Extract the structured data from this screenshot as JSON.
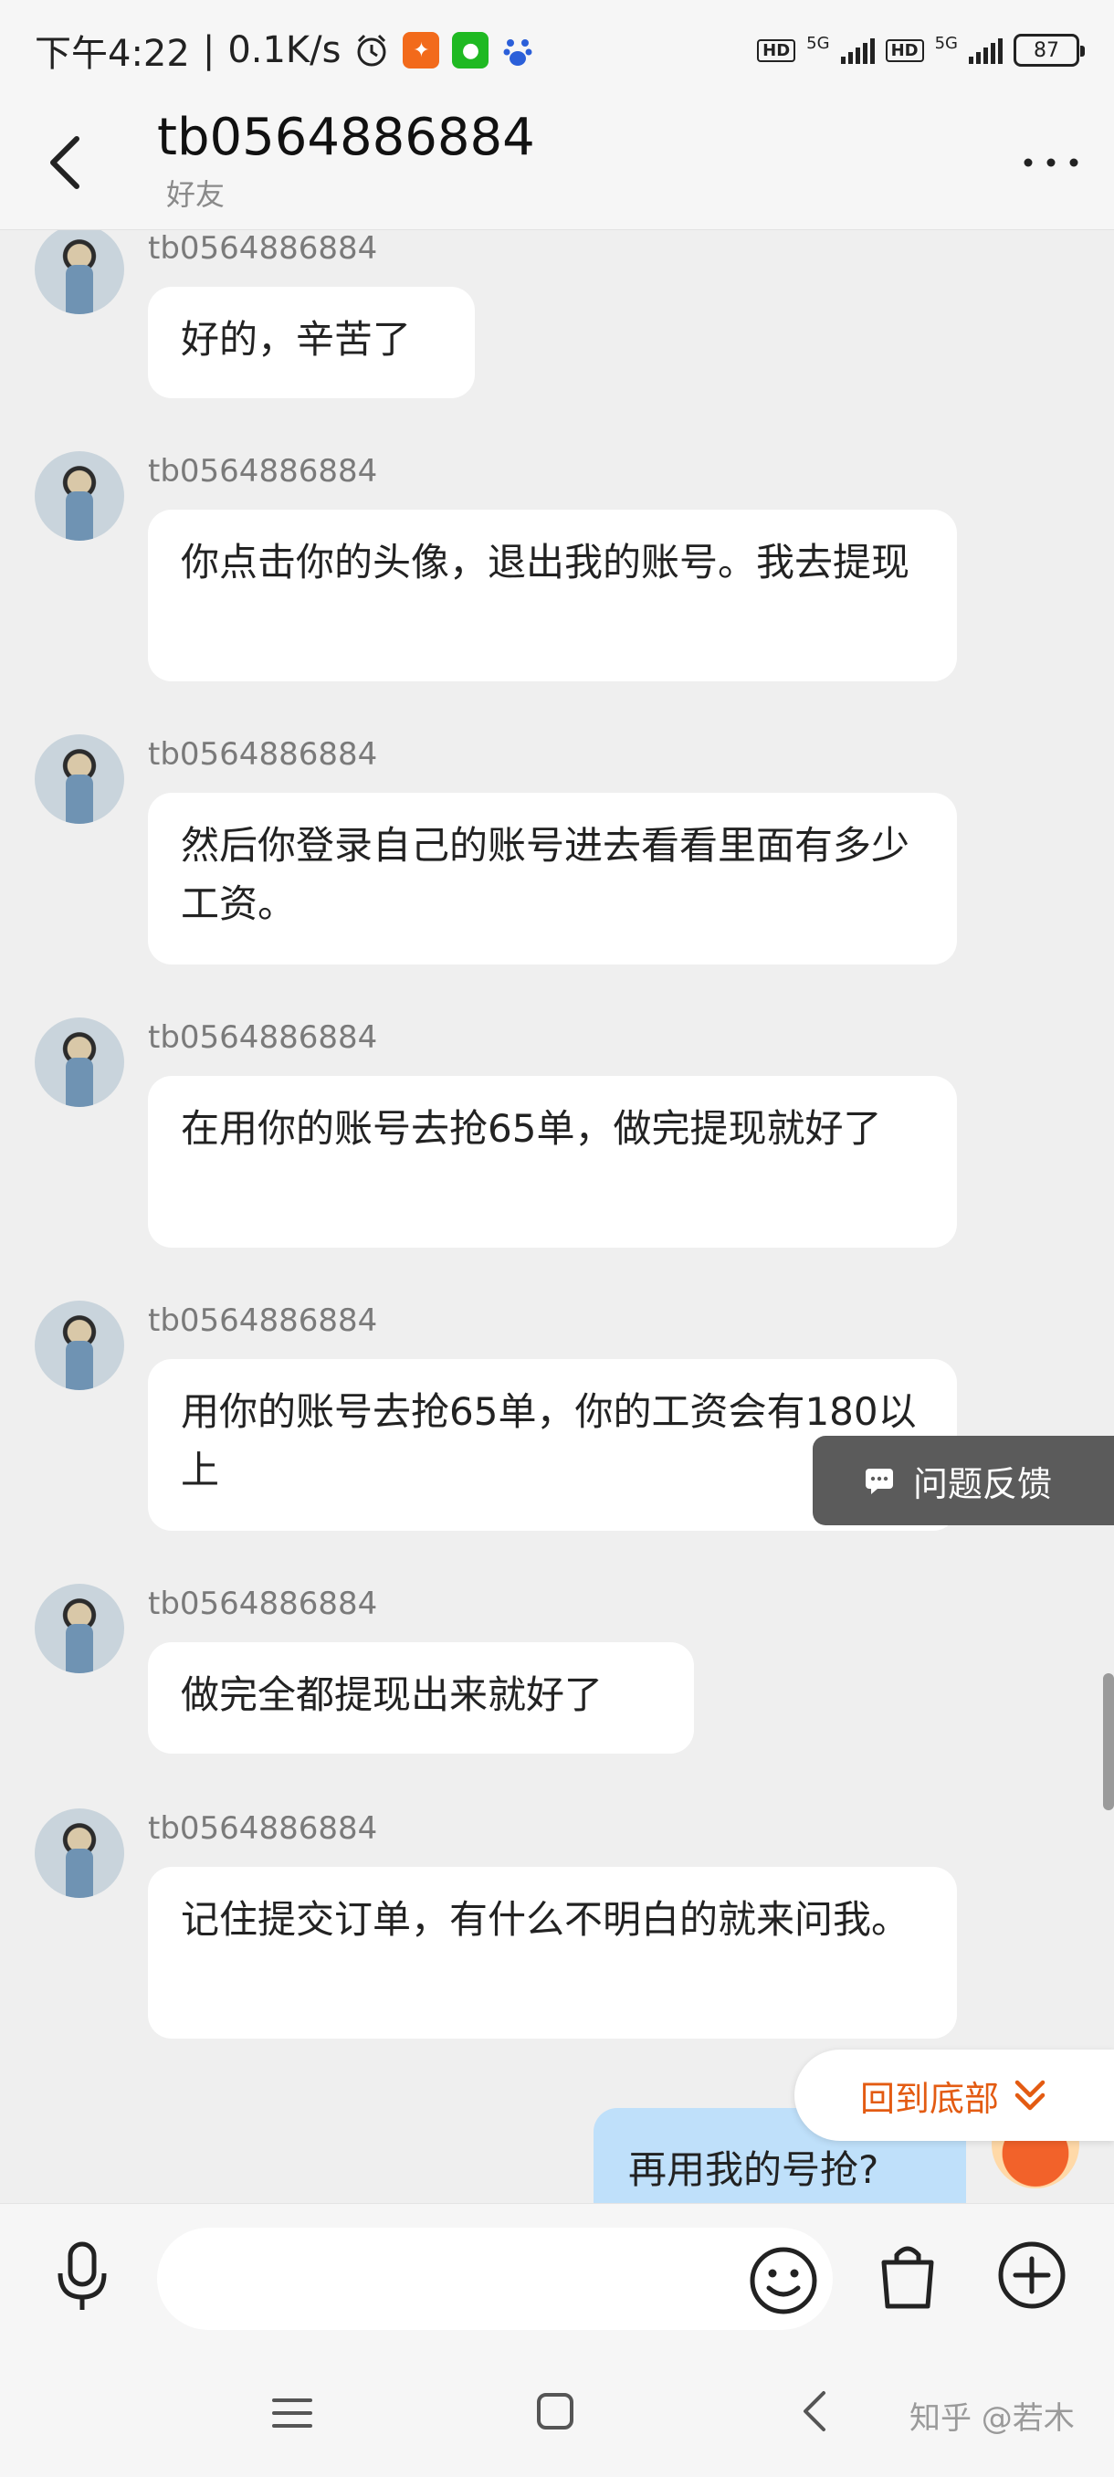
{
  "status_bar": {
    "time": "下午4:22",
    "speed": "0.1K/s",
    "net_label_1": "5G",
    "net_label_2": "5G",
    "hd_label": "HD",
    "battery": "87"
  },
  "header": {
    "title": "tb0564886884",
    "subtitle": "好友"
  },
  "messages": [
    {
      "sender": "tb0564886884",
      "text": "好的，辛苦了"
    },
    {
      "sender": "tb0564886884",
      "text": "你点击你的头像，退出我的账号。我去提现"
    },
    {
      "sender": "tb0564886884",
      "text": "然后你登录自己的账号进去看看里面有多少工资。"
    },
    {
      "sender": "tb0564886884",
      "text": "在用你的账号去抢65单，做完提现就好了"
    },
    {
      "sender": "tb0564886884",
      "text": "用你的账号去抢65单，你的工资会有180以上"
    },
    {
      "sender": "tb0564886884",
      "text": "做完全都提现出来就好了"
    },
    {
      "sender": "tb0564886884",
      "text": "记住提交订单，有什么不明白的就来问我。"
    }
  ],
  "my_message": {
    "text": "再用我的号抢?"
  },
  "floating": {
    "feedback_label": "问题反馈",
    "back_to_bottom_label": "回到底部"
  },
  "watermark": "知乎 @若木",
  "colors": {
    "accent_orange": "#e35b12",
    "my_bubble": "#bfe0fa",
    "feedback_bg": "#5b5b5b"
  }
}
